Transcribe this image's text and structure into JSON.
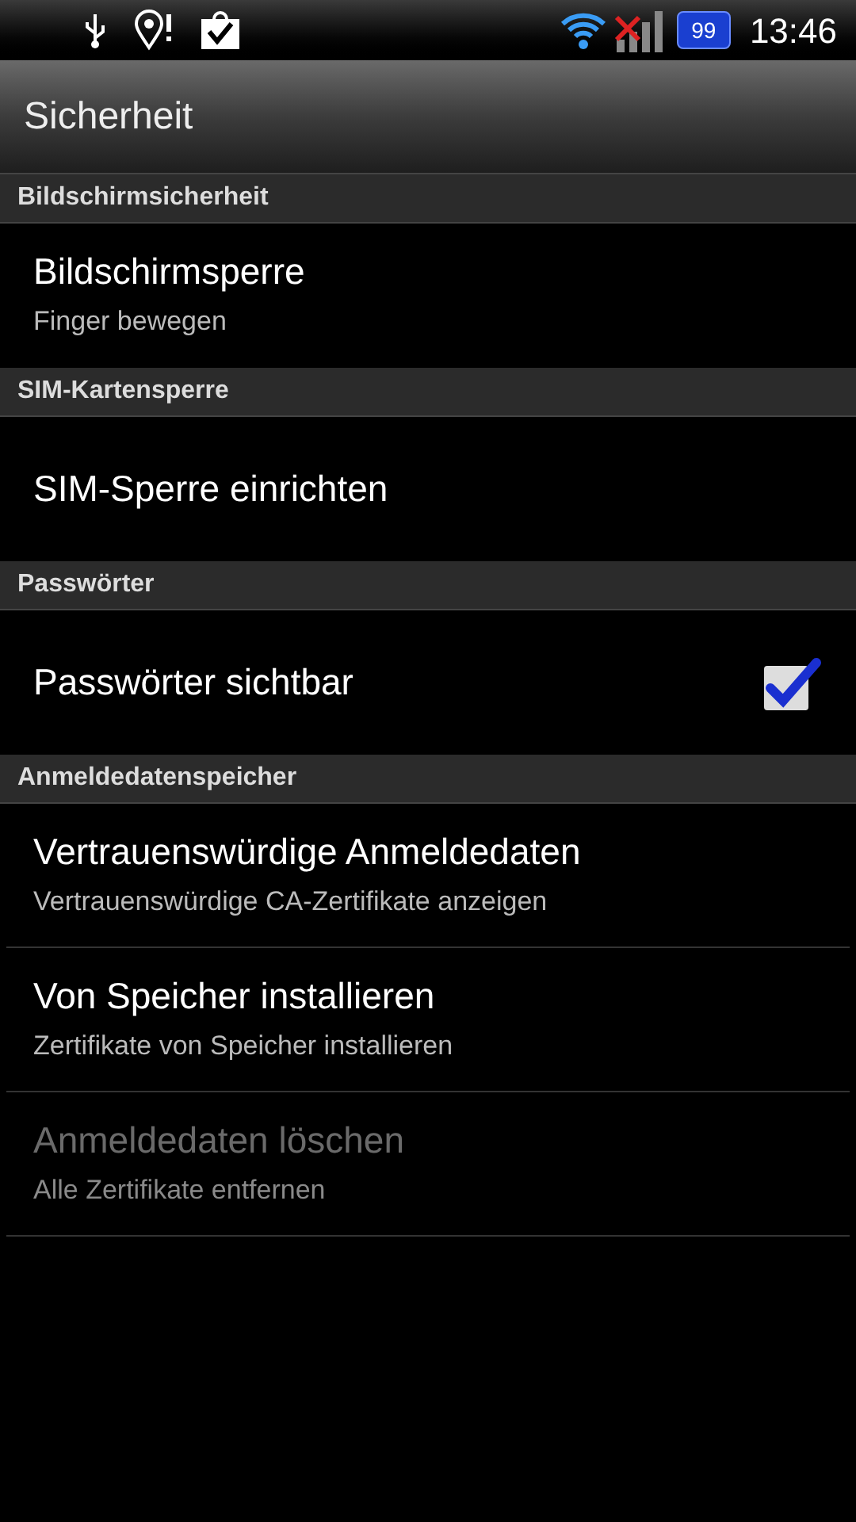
{
  "status_bar": {
    "battery": "99",
    "time": "13:46"
  },
  "title_bar": {
    "title": "Sicherheit"
  },
  "sections": [
    {
      "header": "Bildschirmsicherheit",
      "items": [
        {
          "kind": "text",
          "title": "Bildschirmsperre",
          "summary": "Finger bewegen",
          "disabled": false
        }
      ]
    },
    {
      "header": "SIM-Kartensperre",
      "items": [
        {
          "kind": "text",
          "title": "SIM-Sperre einrichten",
          "disabled": false
        }
      ]
    },
    {
      "header": "Passwörter",
      "items": [
        {
          "kind": "checkbox",
          "title": "Passwörter sichtbar",
          "checked": true,
          "disabled": false
        }
      ]
    },
    {
      "header": "Anmeldedatenspeicher",
      "items": [
        {
          "kind": "text",
          "title": "Vertrauenswürdige Anmeldedaten",
          "summary": "Vertrauenswürdige CA-Zertifikate anzeigen",
          "disabled": false
        },
        {
          "kind": "text",
          "title": "Von Speicher installieren",
          "summary": "Zertifikate von Speicher installieren",
          "disabled": false
        },
        {
          "kind": "text",
          "title": "Anmeldedaten löschen",
          "summary": "Alle Zertifikate entfernen",
          "disabled": true
        }
      ]
    }
  ]
}
